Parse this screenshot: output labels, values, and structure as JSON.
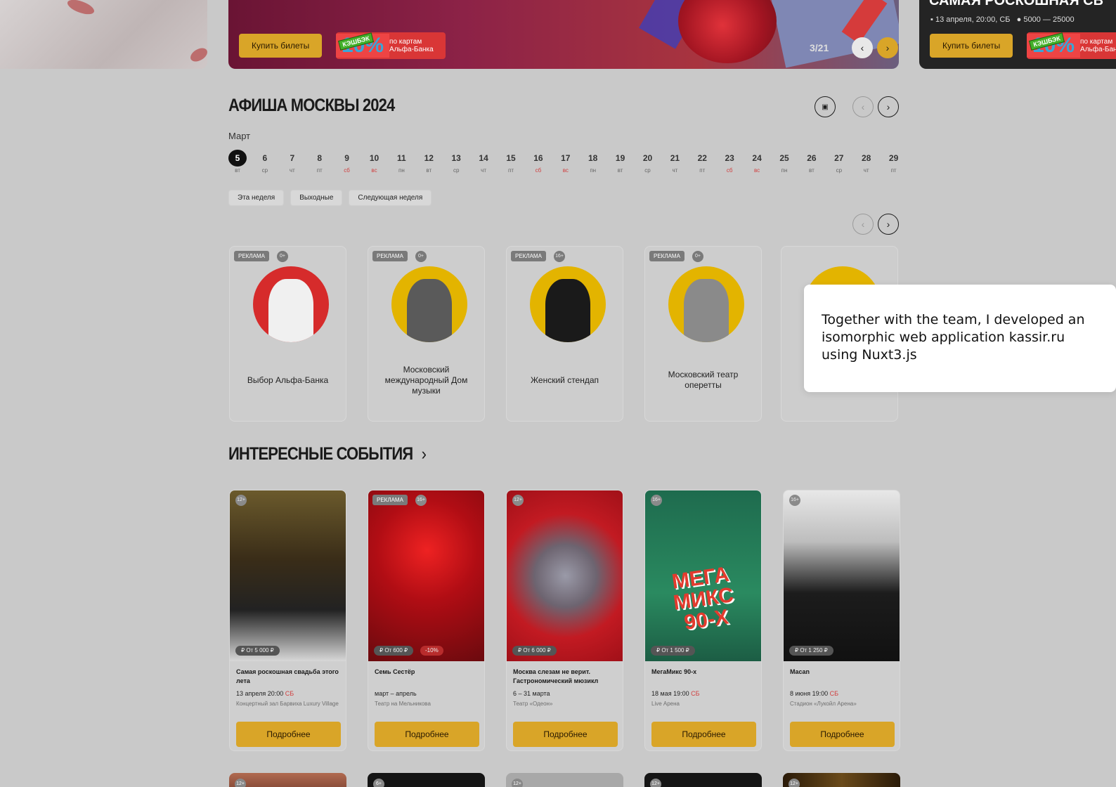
{
  "hero": {
    "buy_label": "Купить билеты",
    "cashback": {
      "percent": "10%",
      "tag": "КЭШБЭК",
      "text": "по картам Альфа-Банка"
    },
    "counter": "3/21",
    "right": {
      "title": "САМАЯ РОСКОШНАЯ СВ",
      "date": "13 апреля, 20:00, СБ",
      "price": "5000 — 25000",
      "buy_label": "Купить билеты",
      "cashback_tag": "КЭШБЭК",
      "cashback_percent": "10%",
      "cashback_text": "по картам Альфа-Бан"
    }
  },
  "afisha": {
    "title": "АФИША МОСКВЫ 2024",
    "month": "Март",
    "days": [
      {
        "n": "5",
        "wd": "вт",
        "active": true
      },
      {
        "n": "6",
        "wd": "ср"
      },
      {
        "n": "7",
        "wd": "чт"
      },
      {
        "n": "8",
        "wd": "пт"
      },
      {
        "n": "9",
        "wd": "сб",
        "we": true
      },
      {
        "n": "10",
        "wd": "вс",
        "we": true
      },
      {
        "n": "11",
        "wd": "пн"
      },
      {
        "n": "12",
        "wd": "вт"
      },
      {
        "n": "13",
        "wd": "ср"
      },
      {
        "n": "14",
        "wd": "чт"
      },
      {
        "n": "15",
        "wd": "пт"
      },
      {
        "n": "16",
        "wd": "сб",
        "we": true
      },
      {
        "n": "17",
        "wd": "вс",
        "we": true
      },
      {
        "n": "18",
        "wd": "пн"
      },
      {
        "n": "19",
        "wd": "вт"
      },
      {
        "n": "20",
        "wd": "ср"
      },
      {
        "n": "21",
        "wd": "чт"
      },
      {
        "n": "22",
        "wd": "пт"
      },
      {
        "n": "23",
        "wd": "сб",
        "we": true
      },
      {
        "n": "24",
        "wd": "вс",
        "we": true
      },
      {
        "n": "25",
        "wd": "пн"
      },
      {
        "n": "26",
        "wd": "вт"
      },
      {
        "n": "27",
        "wd": "ср"
      },
      {
        "n": "28",
        "wd": "чт"
      },
      {
        "n": "29",
        "wd": "пт"
      }
    ],
    "chips": [
      "Эта неделя",
      "Выходные",
      "Следующая неделя"
    ]
  },
  "venues": [
    {
      "ad": "РЕКЛАМА",
      "age": "0+",
      "name": "Выбор Альфа-Банка",
      "bg": "#d62b2b"
    },
    {
      "ad": "РЕКЛАМА",
      "age": "0+",
      "name": "Московский международный Дом музыки",
      "bg": "#e3b400"
    },
    {
      "ad": "РЕКЛАМА",
      "age": "16+",
      "name": "Женский стендап",
      "bg": "#e3b400"
    },
    {
      "ad": "РЕКЛАМА",
      "age": "0+",
      "name": "Московский театр оперетты",
      "bg": "#e3b400"
    }
  ],
  "tooltip": "Together with the team, I developed an isomorphic web application kassir.ru using Nuxt3.js",
  "events": {
    "title": "ИНТЕРЕСНЫЕ СОБЫТИЯ",
    "more_label": "Подробнее",
    "items": [
      {
        "age": "12+",
        "price": "От 5 000 ₽",
        "title": "Самая роскошная свадьба этого лета",
        "date": "13 апреля 20:00",
        "day": "СБ",
        "venue": "Концертный зал Барвиха Luxury Village"
      },
      {
        "ad": "РЕКЛАМА",
        "age": "16+",
        "price": "От 600 ₽",
        "discount": "-10%",
        "title": "Семь Сестёр",
        "date": "март – апрель",
        "day": "",
        "venue": "Театр на Мельникова"
      },
      {
        "age": "12+",
        "price": "От 6 000 ₽",
        "title": "Москва слезам не верит. Гастрономический мюзикл",
        "date": "6 – 31 марта",
        "day": "",
        "venue": "Театр «Одеон»"
      },
      {
        "age": "16+",
        "price": "От 1 500 ₽",
        "title": "МегаМикс 90-х",
        "date": "18 мая 19:00",
        "day": "СБ",
        "venue": "Live Арена",
        "poster": "МЕГА МИКС 90-Х"
      },
      {
        "age": "16+",
        "price": "От 1 250 ₽",
        "title": "Macan",
        "date": "8 июня 19:00",
        "day": "СБ",
        "venue": "Стадион «Лукойл Арена»"
      }
    ]
  },
  "bottom_ages": [
    "12+",
    "6+",
    "12+",
    "12+",
    "12+"
  ]
}
